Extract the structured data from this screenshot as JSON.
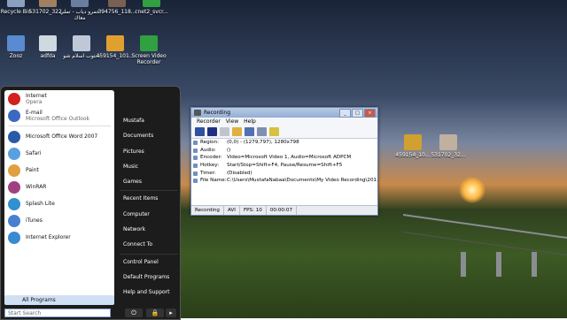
{
  "desktop": {
    "icons_top": [
      {
        "label": "Recycle Bin",
        "color": "#8aa0c0"
      },
      {
        "label": "531702_322...",
        "color": "#a08060"
      },
      {
        "label": "عمرو دياب - تملي معاك",
        "color": "#6a7fa0"
      },
      {
        "label": "394756_118...",
        "color": "#7a6050"
      },
      {
        "label": "cnet2_svcr...",
        "color": "#30a040"
      }
    ],
    "icons_row2": [
      {
        "label": "Zooz",
        "color": "#5a8ad0"
      },
      {
        "label": "adfda",
        "color": "#d0d8e0"
      },
      {
        "label": "ستوب اسلام شو",
        "color": "#c0c8d8"
      },
      {
        "label": "459154_101...",
        "color": "#e0a030"
      },
      {
        "label": "Screen Video Recorder",
        "color": "#30a040"
      }
    ],
    "icons_right": [
      {
        "label": "459154_10...",
        "color": "#d0a030"
      },
      {
        "label": "531702_32...",
        "color": "#c0b0a0"
      }
    ]
  },
  "start_menu": {
    "pinned": [
      {
        "title": "Internet",
        "sub": "Opera",
        "icon": "opera-icon",
        "color": "#d42020"
      },
      {
        "title": "E-mail",
        "sub": "Microsoft Office Outlook",
        "icon": "outlook-icon",
        "color": "#3a6ac0"
      }
    ],
    "recent": [
      {
        "label": "Microsoft Office Word 2007",
        "icon": "word-icon",
        "color": "#2a5aaa"
      },
      {
        "label": "Safari",
        "icon": "safari-icon",
        "color": "#5aa0e0"
      },
      {
        "label": "Paint",
        "icon": "paint-icon",
        "color": "#e0a040"
      },
      {
        "label": "WinRAR",
        "icon": "winrar-icon",
        "color": "#a04080"
      },
      {
        "label": "Splash Lite",
        "icon": "splash-icon",
        "color": "#3090d0"
      },
      {
        "label": "iTunes",
        "icon": "itunes-icon",
        "color": "#4a80d0"
      },
      {
        "label": "Internet Explorer",
        "icon": "ie-icon",
        "color": "#3a8ad0"
      }
    ],
    "all_programs": "All Programs",
    "search_placeholder": "Start Search",
    "right_items": [
      "Mustafa",
      "Documents",
      "Pictures",
      "Music",
      "Games",
      "Recent Items",
      "Computer",
      "Network",
      "Connect To",
      "Control Panel",
      "Default Programs",
      "Help and Support"
    ]
  },
  "recording_window": {
    "title": "Recording",
    "menu": [
      "Recorder",
      "View",
      "Help"
    ],
    "fields": [
      {
        "key": "Region:",
        "value": "(0,0) - (1279,797), 1280x798"
      },
      {
        "key": "Audio:",
        "value": "()"
      },
      {
        "key": "Encoder:",
        "value": "Video=Microsoft Video 1, Audio=Microsoft ADPCM"
      },
      {
        "key": "Hotkey:",
        "value": "Start/Stop=Shift+F4, Pause/Resume=Shift+F5"
      },
      {
        "key": "Timer:",
        "value": "(Disabled)"
      },
      {
        "key": "File Name:",
        "value": "C:\\Users\\MustafaNabaa\\Documents\\My Video Recording\\201..."
      }
    ],
    "status": [
      "Recording",
      "AVI",
      "FPS: 10",
      "00:00:07"
    ]
  }
}
